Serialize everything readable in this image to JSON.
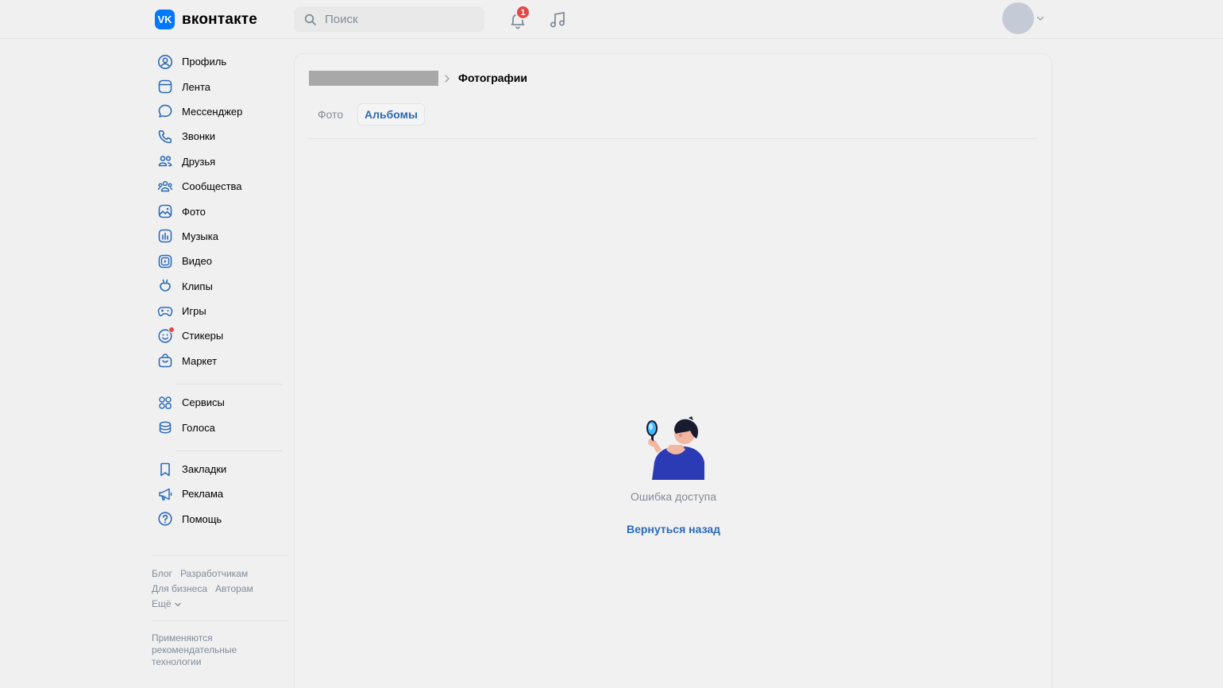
{
  "header": {
    "logo_mark": "VK",
    "logo_text": "вконтакте",
    "search_placeholder": "Поиск",
    "notifications_count": "1"
  },
  "nav": {
    "items": [
      {
        "label": "Профиль"
      },
      {
        "label": "Лента"
      },
      {
        "label": "Мессенджер"
      },
      {
        "label": "Звонки"
      },
      {
        "label": "Друзья"
      },
      {
        "label": "Сообщества"
      },
      {
        "label": "Фото"
      },
      {
        "label": "Музыка"
      },
      {
        "label": "Видео"
      },
      {
        "label": "Клипы"
      },
      {
        "label": "Игры"
      },
      {
        "label": "Стикеры"
      },
      {
        "label": "Маркет"
      },
      {
        "label": "Сервисы"
      },
      {
        "label": "Голоса"
      },
      {
        "label": "Закладки"
      },
      {
        "label": "Реклама"
      },
      {
        "label": "Помощь"
      }
    ]
  },
  "footer": {
    "links": [
      "Блог",
      "Разработчикам",
      "Для бизнеса",
      "Авторам",
      "Ещё"
    ],
    "note": "Применяются рекомендательные технологии"
  },
  "content": {
    "breadcrumb_current": "Фотографии",
    "tabs": [
      {
        "label": "Фото"
      },
      {
        "label": "Альбомы"
      }
    ],
    "active_tab": "Альбомы",
    "error_text": "Ошибка доступа",
    "back_link": "Вернуться назад"
  },
  "colors": {
    "accent": "#0077ff",
    "link": "#2d6ab8",
    "badge": "#e64646",
    "muted": "#818c99"
  }
}
